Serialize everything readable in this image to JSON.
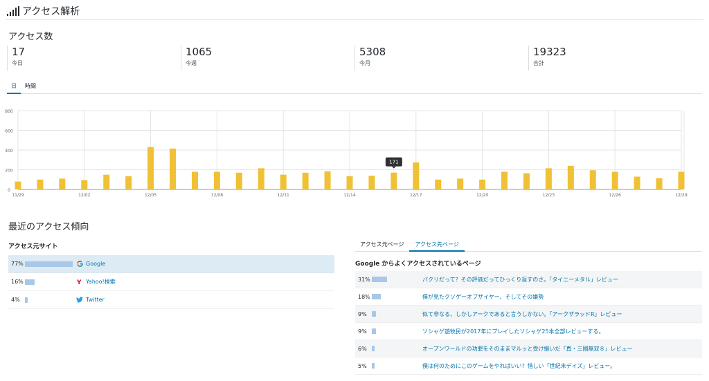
{
  "header": {
    "title": "アクセス解析",
    "icon": "signal-bars-icon"
  },
  "access_count": {
    "title": "アクセス数",
    "stats": [
      {
        "value": "17",
        "label": "今日"
      },
      {
        "value": "1065",
        "label": "今週"
      },
      {
        "value": "5308",
        "label": "今月"
      },
      {
        "value": "19323",
        "label": "合計"
      }
    ]
  },
  "period_tabs": {
    "day": "日",
    "hour": "時間",
    "active": "day"
  },
  "chart_data": {
    "type": "bar",
    "categories": [
      "11/29",
      "11/30",
      "12/01",
      "12/02",
      "12/03",
      "12/04",
      "12/05",
      "12/06",
      "12/07",
      "12/08",
      "12/09",
      "12/10",
      "12/11",
      "12/12",
      "12/13",
      "12/14",
      "12/15",
      "12/16",
      "12/17",
      "12/18",
      "12/19",
      "12/20",
      "12/21",
      "12/22",
      "12/23",
      "12/24",
      "12/25",
      "12/26",
      "12/27",
      "12/28",
      "12/29"
    ],
    "x_tick_labels": [
      "11/29",
      "12/02",
      "12/05",
      "12/08",
      "12/11",
      "12/14",
      "12/17",
      "12/20",
      "12/23",
      "12/26",
      "12/29"
    ],
    "values": [
      80,
      100,
      110,
      95,
      150,
      135,
      430,
      415,
      180,
      180,
      170,
      215,
      150,
      170,
      185,
      135,
      140,
      171,
      275,
      100,
      110,
      100,
      180,
      165,
      215,
      240,
      195,
      180,
      130,
      115,
      180
    ],
    "ylim": [
      0,
      800
    ],
    "y_ticks": [
      0,
      200,
      400,
      600,
      800
    ],
    "bar_color": "#f0c135",
    "grid": true,
    "tooltip": {
      "category": "12/16",
      "text": "171"
    }
  },
  "trend": {
    "title": "最近のアクセス傾向",
    "sources": {
      "title": "アクセス元サイト",
      "rows": [
        {
          "pct_text": "77%",
          "pct": 77,
          "name": "Google",
          "icon": "google-icon"
        },
        {
          "pct_text": "16%",
          "pct": 16,
          "name": "Yahoo!検索",
          "icon": "yahoo-icon"
        },
        {
          "pct_text": "4%",
          "pct": 4,
          "name": "Twitter",
          "icon": "twitter-icon"
        }
      ]
    },
    "tabs": {
      "source": "アクセス元ページ",
      "destination": "アクセス先ページ",
      "active": "destination"
    },
    "destinations": {
      "title": "Google からよくアクセスされているページ",
      "rows": [
        {
          "pct_text": "31%",
          "pct": 31,
          "title": "パクリだって？その評価だってひっくり返すのさ。「タイニーメタル」レビュー"
        },
        {
          "pct_text": "18%",
          "pct": 18,
          "title": "僕が見たクソゲーオブザイヤー、そしてその嫌勢"
        },
        {
          "pct_text": "9%",
          "pct": 9,
          "title": "似て非なる、しかしアークであると言うしかない。「アークザラッドR」レビュー"
        },
        {
          "pct_text": "9%",
          "pct": 9,
          "title": "ソシャゲ遊牧民が2017年にプレイしたソシャゲ25本全部レビューする。"
        },
        {
          "pct_text": "6%",
          "pct": 6,
          "title": "オープンワールドの功罪をそのままマルッと受け継いだ「真・三國無双８」レビュー"
        },
        {
          "pct_text": "5%",
          "pct": 5,
          "title": "僕は何のためにこのゲームをやればいい？惜しい「世紀末デイズ」レビュー。"
        }
      ]
    }
  }
}
